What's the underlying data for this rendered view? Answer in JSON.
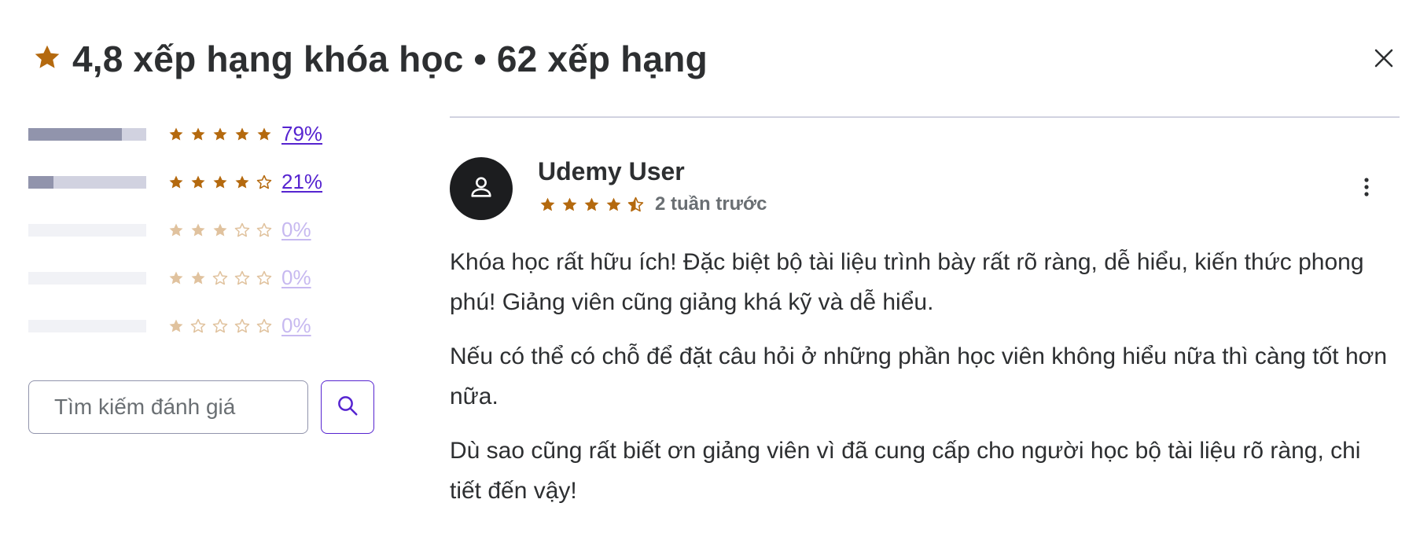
{
  "header": {
    "title": "4,8 xếp hạng khóa học • 62 xếp hạng",
    "icon": "star-icon",
    "close_icon": "close-icon"
  },
  "colors": {
    "star": "#b4690e",
    "accent": "#5624d0",
    "bar_bg": "#d1d2e0",
    "bar_fill": "#9194ac",
    "text": "#2d2f31",
    "muted": "#6a6f73"
  },
  "breakdown": [
    {
      "stars": 5,
      "percent_label": "79%",
      "fill_fraction": 0.79
    },
    {
      "stars": 4,
      "percent_label": "21%",
      "fill_fraction": 0.21
    },
    {
      "stars": 3,
      "percent_label": "0%",
      "fill_fraction": 0
    },
    {
      "stars": 2,
      "percent_label": "0%",
      "fill_fraction": 0
    },
    {
      "stars": 1,
      "percent_label": "0%",
      "fill_fraction": 0
    }
  ],
  "search": {
    "placeholder": "Tìm kiếm đánh giá",
    "value": "",
    "button_icon": "search-icon"
  },
  "review": {
    "user_name": "Udemy User",
    "rating": 4.5,
    "time": "2 tuần trước",
    "avatar_icon": "user-icon",
    "more_icon": "more-vertical-icon",
    "paragraphs": [
      "Khóa học rất hữu ích! Đặc biệt bộ tài liệu trình bày rất rõ ràng, dễ hiểu, kiến thức phong phú! Giảng viên cũng giảng khá kỹ và dễ hiểu.",
      "Nếu có thể có chỗ để đặt câu hỏi ở những phần học viên không hiểu nữa thì càng tốt hơn nữa.",
      "Dù sao cũng rất biết ơn giảng viên vì đã cung cấp cho người học bộ tài liệu rõ ràng, chi tiết đến vậy!"
    ]
  }
}
